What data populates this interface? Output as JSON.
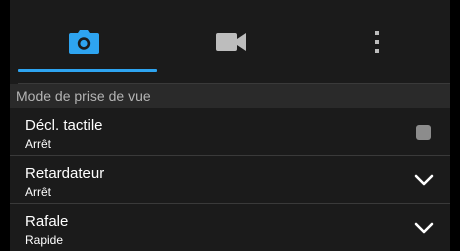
{
  "tabs": [
    {
      "id": "camera",
      "icon": "camera-icon",
      "active": true
    },
    {
      "id": "video",
      "icon": "video-camera-icon",
      "active": false
    },
    {
      "id": "more",
      "icon": "more-vert-icon",
      "active": false
    }
  ],
  "section": {
    "title": "Mode de prise de vue"
  },
  "settings": [
    {
      "title": "Décl. tactile",
      "value": "Arrêt",
      "control": "checkbox",
      "checked": false
    },
    {
      "title": "Retardateur",
      "value": "Arrêt",
      "control": "dropdown"
    },
    {
      "title": "Rafale",
      "value": "Rapide",
      "control": "dropdown"
    }
  ],
  "colors": {
    "accent": "#2ea4f0",
    "background": "#1b1b1b",
    "section_header_bg": "#2a2a2a",
    "inactive_icon": "#bdbdbd"
  }
}
